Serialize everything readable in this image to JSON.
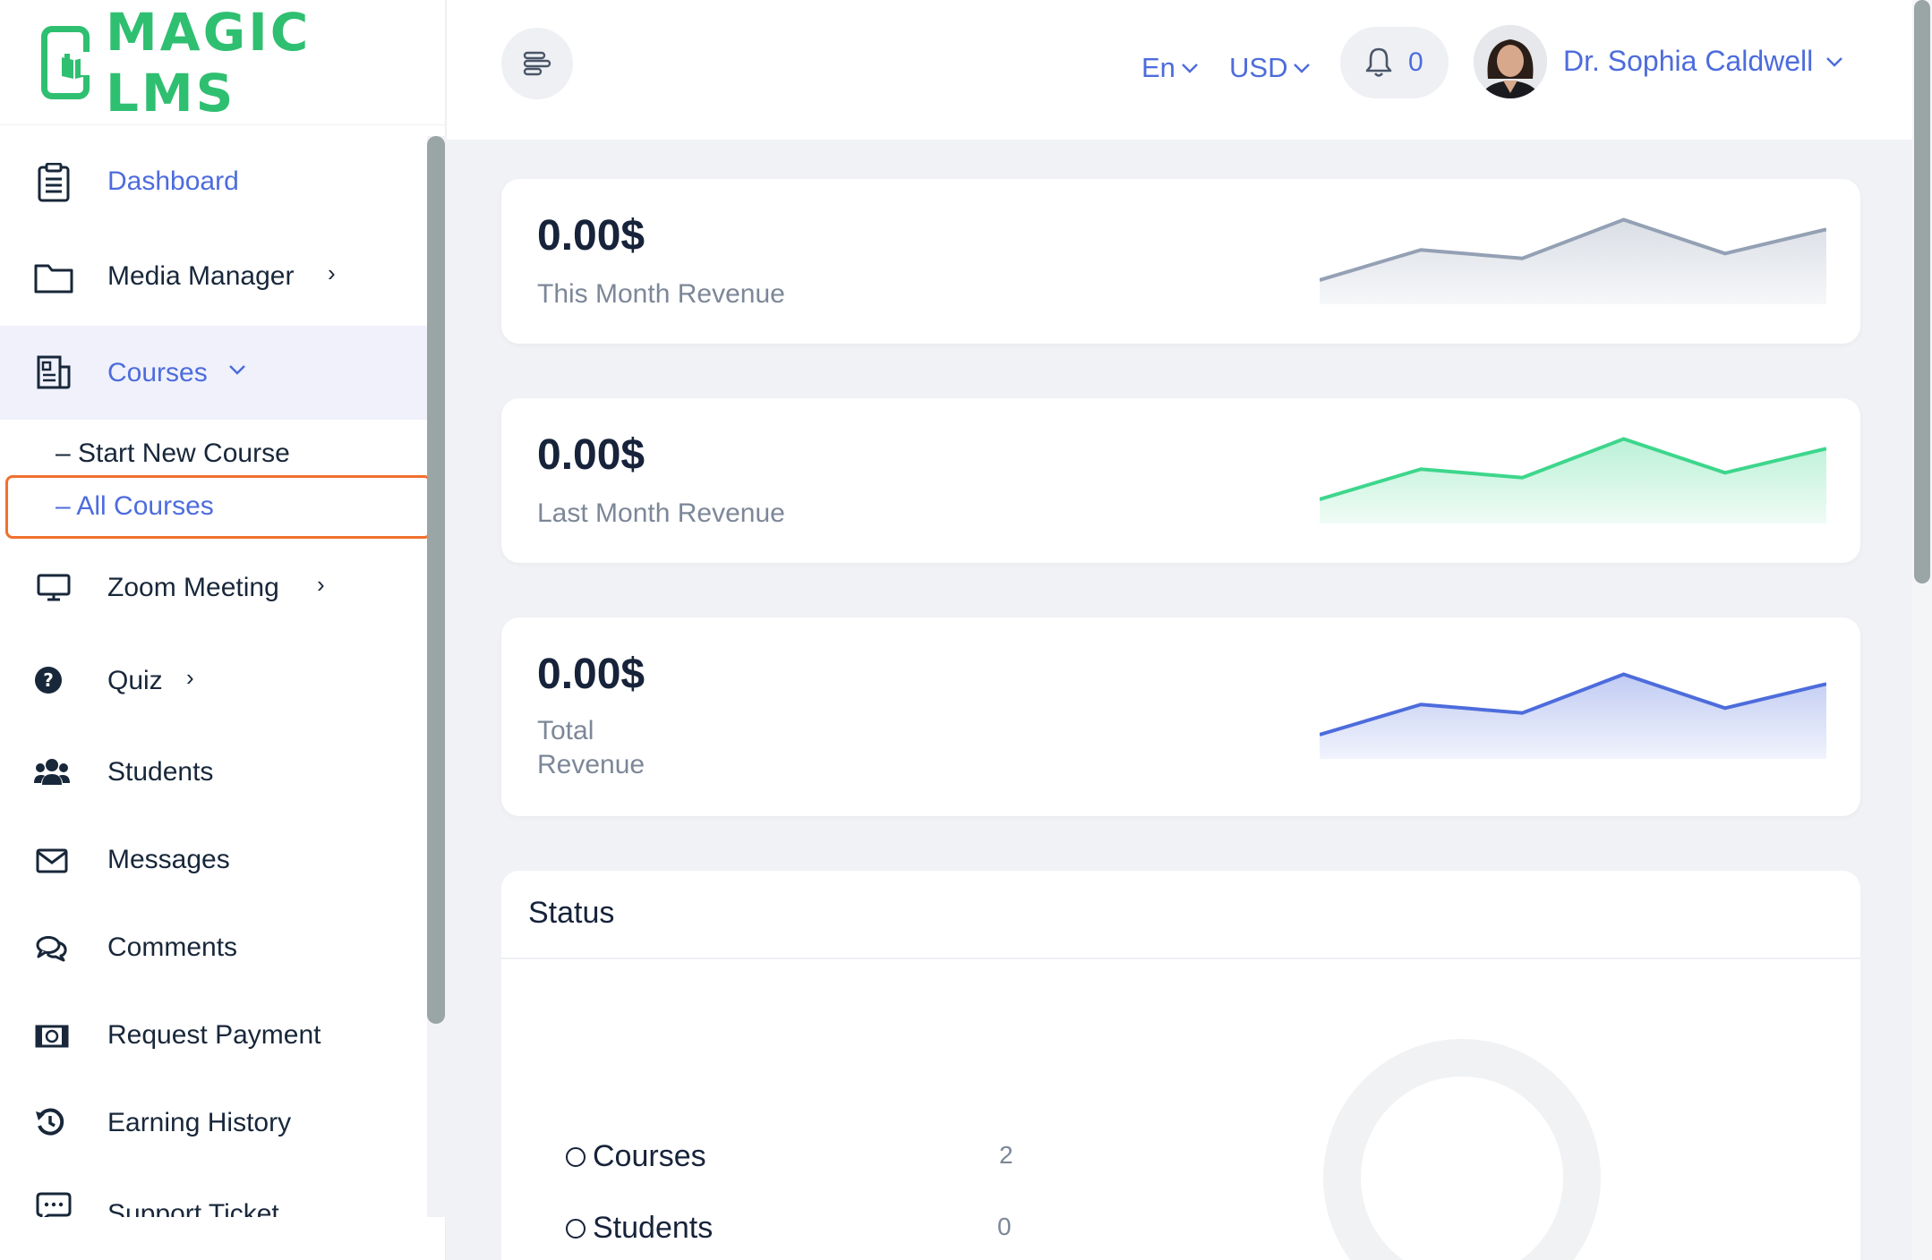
{
  "brand": {
    "name": "MAGIC LMS",
    "color": "#2fbf71"
  },
  "accent": "#4d6cdc",
  "sidebar": {
    "items": [
      {
        "label": "Dashboard",
        "icon": "clipboard-icon",
        "active": true
      },
      {
        "label": "Media Manager",
        "icon": "folder-icon",
        "chevron": "›"
      },
      {
        "label": "Courses",
        "icon": "newspaper-icon",
        "chevron": "⌄",
        "open": true
      },
      {
        "label": "Zoom Meeting",
        "icon": "monitor-icon",
        "chevron": "›"
      },
      {
        "label": "Quiz",
        "icon": "question-circle-icon",
        "chevron": "›"
      },
      {
        "label": "Students",
        "icon": "users-icon"
      },
      {
        "label": "Messages",
        "icon": "envelope-icon"
      },
      {
        "label": "Comments",
        "icon": "comments-icon"
      },
      {
        "label": "Request Payment",
        "icon": "money-bill-icon"
      },
      {
        "label": "Earning History",
        "icon": "history-icon"
      },
      {
        "label": "Support Ticket",
        "icon": "chat-dots-icon"
      }
    ],
    "courses_sub": [
      {
        "label": "– Start New Course"
      },
      {
        "label": "– All Courses",
        "selected": true
      }
    ]
  },
  "header": {
    "language": "En",
    "currency": "USD",
    "notifications": "0",
    "user_name": "Dr. Sophia Caldwell"
  },
  "cards": [
    {
      "amount": "0.00$",
      "label": "This Month Revenue",
      "color": "#94a0b4",
      "spark": [
        20,
        45,
        38,
        70,
        42,
        62
      ]
    },
    {
      "amount": "0.00$",
      "label": "Last Month Revenue",
      "color": "#3dd68c",
      "spark": [
        20,
        45,
        38,
        70,
        42,
        62
      ]
    },
    {
      "amount": "0.00$",
      "label_line1": "Total",
      "label_line2": "Revenue",
      "color": "#4d6cdc",
      "spark": [
        20,
        45,
        38,
        70,
        42,
        62
      ]
    }
  ],
  "status": {
    "title": "Status",
    "rows": [
      {
        "name": "Courses",
        "value": "2"
      },
      {
        "name": "Students",
        "value": "0"
      }
    ]
  }
}
